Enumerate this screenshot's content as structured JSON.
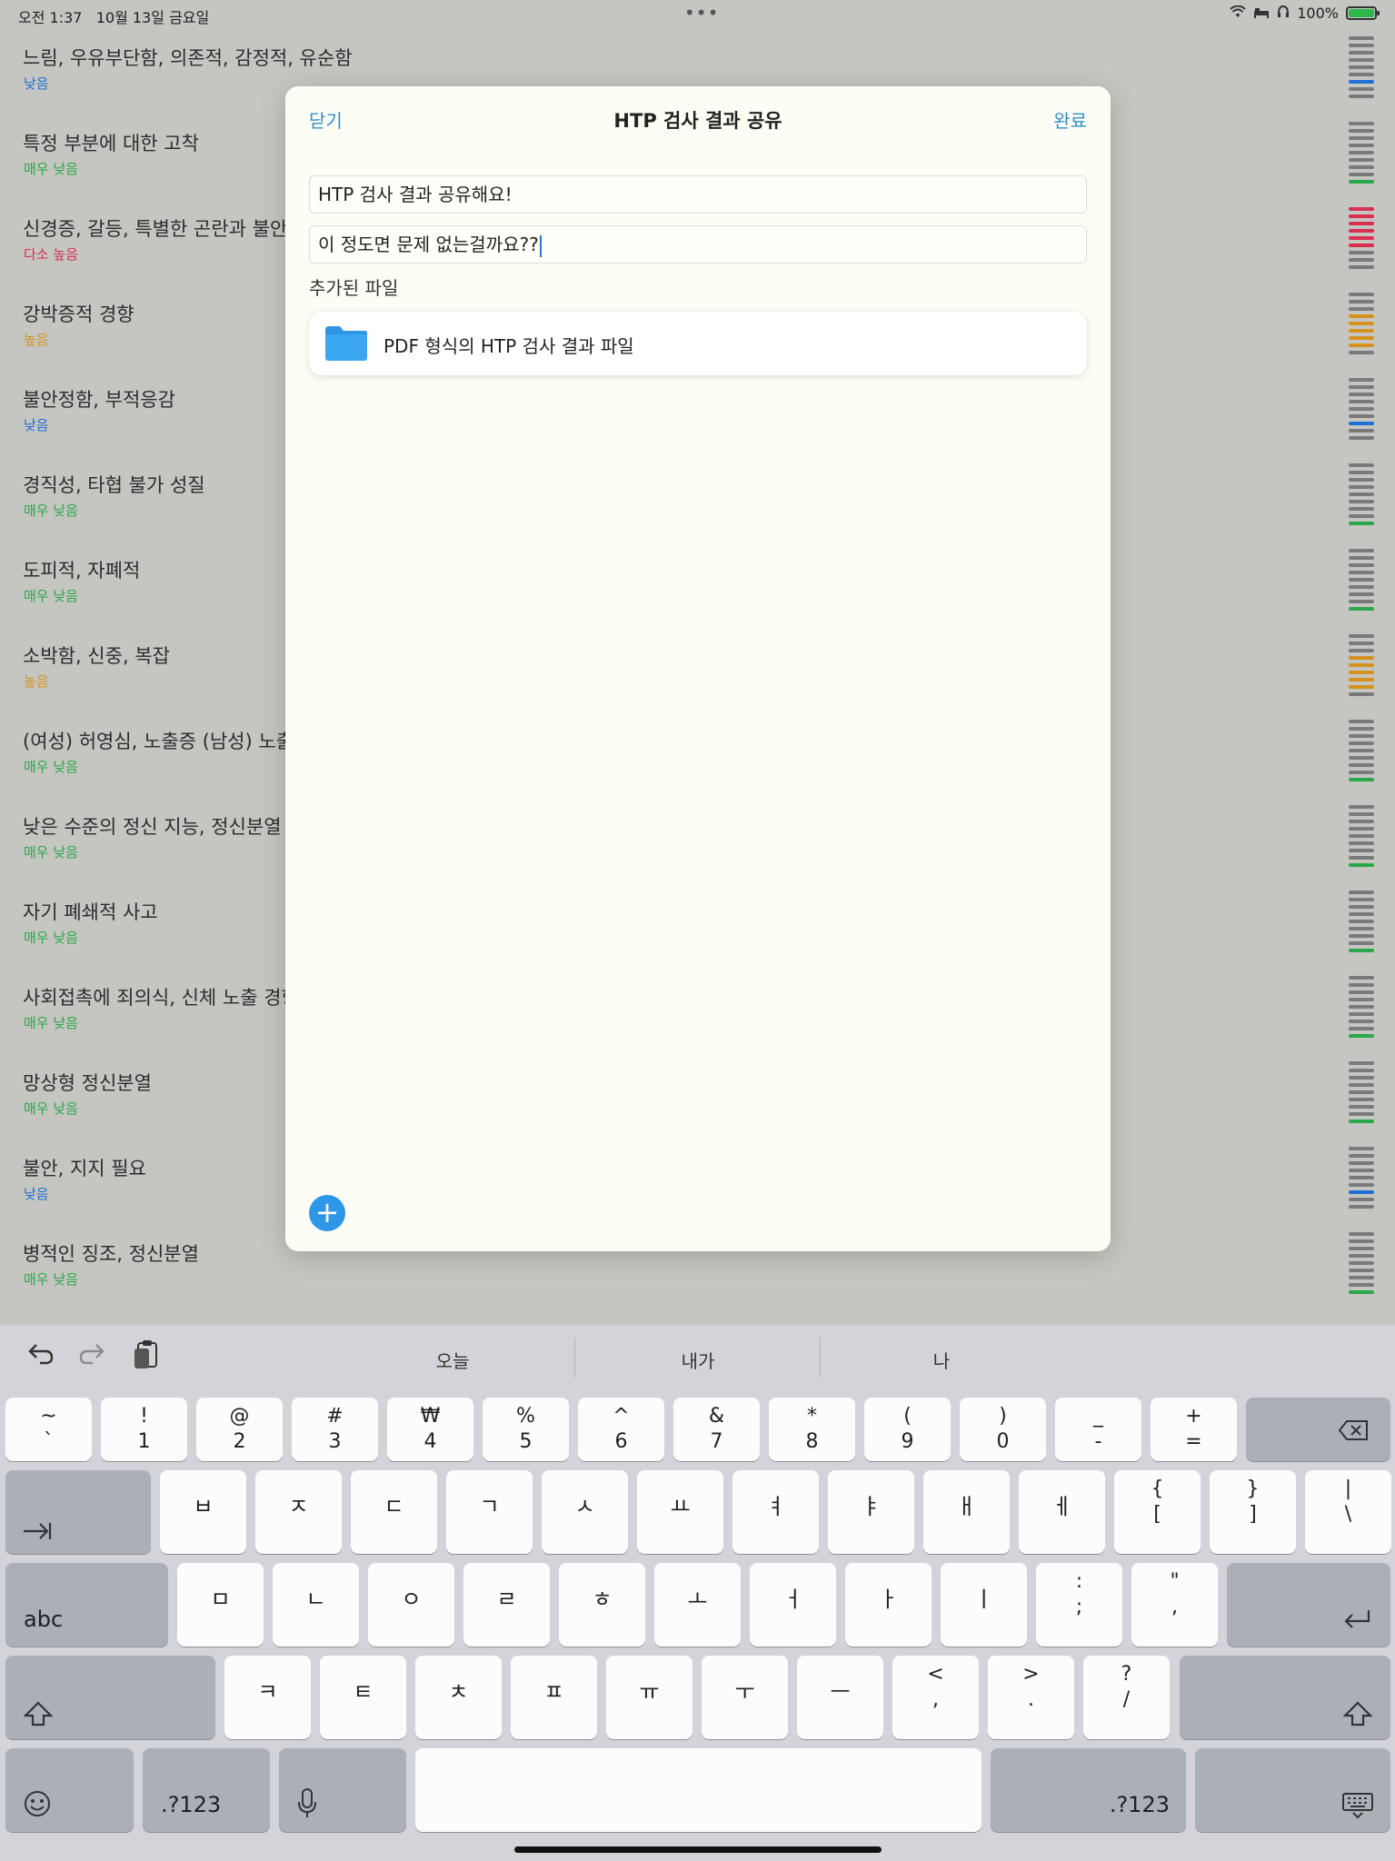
{
  "status_bar": {
    "time": "오전 1:37",
    "date": "10월 13일 금요일",
    "battery": "100%",
    "battery_level": 1.0
  },
  "colors": {
    "accent": "#2f8fcf",
    "very_low": "#2aa84a",
    "low": "#1f6fd6",
    "high": "#d6921e",
    "somewhat_high": "#d9304f"
  },
  "list": [
    {
      "title": "느림, 우유부단함, 의존적, 감정적, 유순함",
      "level": "낮음",
      "level_key": "low"
    },
    {
      "title": "특정 부분에 대한 고착",
      "level": "매우 낮음",
      "level_key": "very_low"
    },
    {
      "title": "신경증, 갈등, 특별한 곤란과 불안",
      "level": "다소 높음",
      "level_key": "somewhat_high"
    },
    {
      "title": "강박증적 경향",
      "level": "높음",
      "level_key": "high"
    },
    {
      "title": "불안정함, 부적응감",
      "level": "낮음",
      "level_key": "low"
    },
    {
      "title": "경직성, 타협 불가 성질",
      "level": "매우 낮음",
      "level_key": "very_low"
    },
    {
      "title": "도피적, 자폐적",
      "level": "매우 낮음",
      "level_key": "very_low"
    },
    {
      "title": "소박함, 신중, 복잡",
      "level": "높음",
      "level_key": "high"
    },
    {
      "title": "(여성) 허영심, 노출증 (남성) 노출",
      "level": "매우 낮음",
      "level_key": "very_low"
    },
    {
      "title": "낮은 수준의 정신 지능, 정신분열",
      "level": "매우 낮음",
      "level_key": "very_low"
    },
    {
      "title": "자기 폐쇄적 사고",
      "level": "매우 낮음",
      "level_key": "very_low"
    },
    {
      "title": "사회접촉에 죄의식, 신체 노출 경향",
      "level": "매우 낮음",
      "level_key": "very_low"
    },
    {
      "title": "망상형 정신분열",
      "level": "매우 낮음",
      "level_key": "very_low"
    },
    {
      "title": "불안, 지지 필요",
      "level": "낮음",
      "level_key": "low"
    },
    {
      "title": "병적인 징조, 정신분열",
      "level": "매우 낮음",
      "level_key": "very_low"
    }
  ],
  "modal": {
    "close_label": "닫기",
    "title": "HTP 검사 결과 공유",
    "done_label": "완료",
    "title_field": "HTP 검사 결과 공유해요!",
    "body_field": "이 정도면 문제 없는걸까요??",
    "attached_label": "추가된 파일",
    "file_name": "PDF 형식의 HTP 검사 결과 파일",
    "add_icon": "plus-icon"
  },
  "keyboard": {
    "suggestions": [
      "오늘",
      "내가",
      "나"
    ],
    "row1": [
      {
        "top": "~",
        "bot": "`"
      },
      {
        "top": "!",
        "bot": "1"
      },
      {
        "top": "@",
        "bot": "2"
      },
      {
        "top": "#",
        "bot": "3"
      },
      {
        "top": "₩",
        "bot": "4"
      },
      {
        "top": "%",
        "bot": "5"
      },
      {
        "top": "^",
        "bot": "6"
      },
      {
        "top": "&",
        "bot": "7"
      },
      {
        "top": "*",
        "bot": "8"
      },
      {
        "top": "(",
        "bot": "9"
      },
      {
        "top": ")",
        "bot": "0"
      },
      {
        "top": "_",
        "bot": "-"
      },
      {
        "top": "+",
        "bot": "="
      }
    ],
    "row2": [
      "ㅂ",
      "ㅈ",
      "ㄷ",
      "ㄱ",
      "ㅅ",
      "ㅛ",
      "ㅕ",
      "ㅑ",
      "ㅐ",
      "ㅔ"
    ],
    "row2_symbols": [
      {
        "top": "{",
        "bot": "["
      },
      {
        "top": "}",
        "bot": "]"
      },
      {
        "top": "|",
        "bot": "\\"
      }
    ],
    "row3": [
      "ㅁ",
      "ㄴ",
      "ㅇ",
      "ㄹ",
      "ㅎ",
      "ㅗ",
      "ㅓ",
      "ㅏ",
      "ㅣ"
    ],
    "row3_symbols": [
      {
        "top": ":",
        "bot": ";"
      },
      {
        "top": "\"",
        "bot": ","
      }
    ],
    "row4": [
      "ㅋ",
      "ㅌ",
      "ㅊ",
      "ㅍ",
      "ㅠ",
      "ㅜ",
      "ㅡ"
    ],
    "row4_symbols": [
      {
        "top": "<",
        "bot": ","
      },
      {
        "top": ">",
        "bot": "."
      },
      {
        "top": "?",
        "bot": "/"
      }
    ],
    "abc_label": "abc",
    "numbers_label": ".?123"
  }
}
